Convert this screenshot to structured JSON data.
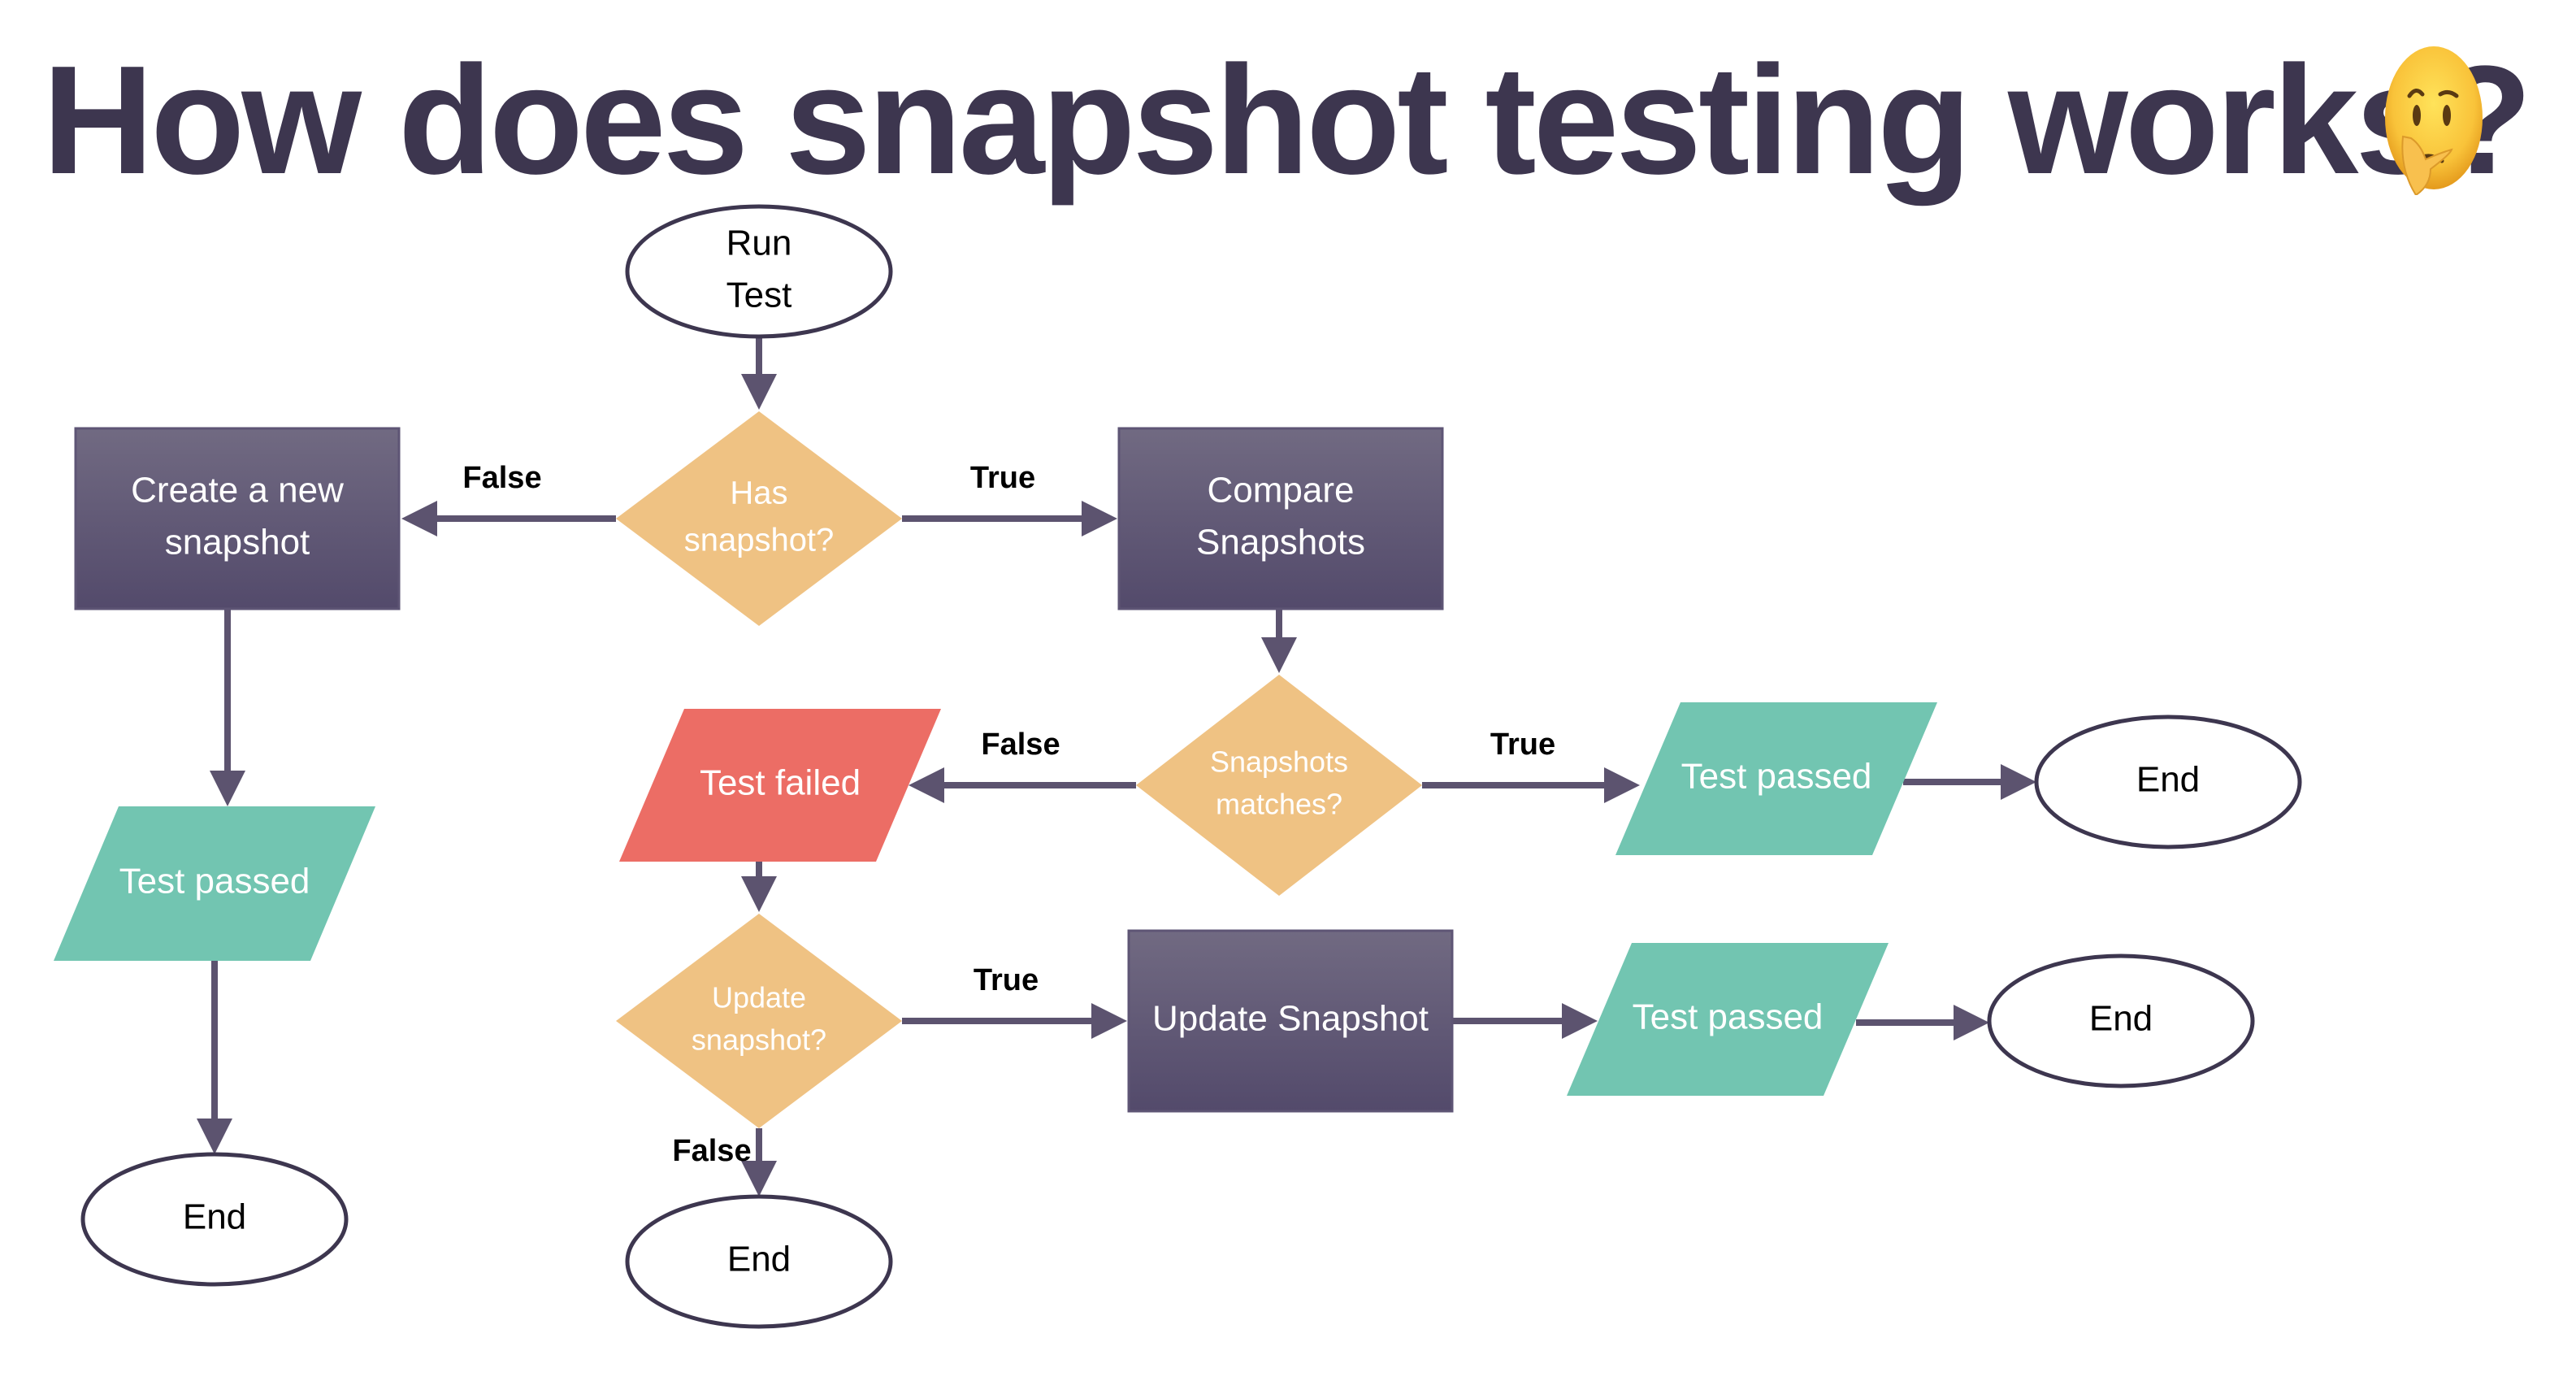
{
  "title": "How does snapshot testing works?",
  "title_emoji": "thinking-face-emoji",
  "colors": {
    "title": "#3d364f",
    "process_top": "#716a82",
    "process_bottom": "#534a6b",
    "decision": "#efc283",
    "passed": "#72c5b1",
    "failed": "#ec6d65",
    "connector": "#5c536f",
    "terminal_stroke": "#3d364f",
    "label": "#000000"
  },
  "nodes": {
    "run_test": {
      "type": "terminal",
      "lines": [
        "Run",
        "Test"
      ]
    },
    "has_snapshot": {
      "type": "decision",
      "lines": [
        "Has",
        "snapshot?"
      ]
    },
    "create_snapshot": {
      "type": "process",
      "lines": [
        "Create a new",
        "snapshot"
      ]
    },
    "compare_snapshots": {
      "type": "process",
      "lines": [
        "Compare",
        "Snapshots"
      ]
    },
    "snapshots_match": {
      "type": "decision",
      "lines": [
        "Snapshots",
        "matches?"
      ]
    },
    "test_failed": {
      "type": "io-failed",
      "lines": [
        "Test failed"
      ]
    },
    "test_passed_match": {
      "type": "io-passed",
      "lines": [
        "Test passed"
      ]
    },
    "end_match": {
      "type": "terminal",
      "lines": [
        "End"
      ]
    },
    "update_question": {
      "type": "decision",
      "lines": [
        "Update",
        "snapshot?"
      ]
    },
    "update_snapshot": {
      "type": "process",
      "lines": [
        "Update Snapshot"
      ]
    },
    "test_passed_update": {
      "type": "io-passed",
      "lines": [
        "Test passed"
      ]
    },
    "end_update": {
      "type": "terminal",
      "lines": [
        "End"
      ]
    },
    "test_passed_new": {
      "type": "io-passed",
      "lines": [
        "Test passed"
      ]
    },
    "end_new": {
      "type": "terminal",
      "lines": [
        "End"
      ]
    },
    "end_no_update": {
      "type": "terminal",
      "lines": [
        "End"
      ]
    }
  },
  "edges": [
    {
      "from": "run_test",
      "to": "has_snapshot",
      "label": ""
    },
    {
      "from": "has_snapshot",
      "to": "create_snapshot",
      "label": "False"
    },
    {
      "from": "has_snapshot",
      "to": "compare_snapshots",
      "label": "True"
    },
    {
      "from": "create_snapshot",
      "to": "test_passed_new",
      "label": ""
    },
    {
      "from": "test_passed_new",
      "to": "end_new",
      "label": ""
    },
    {
      "from": "compare_snapshots",
      "to": "snapshots_match",
      "label": ""
    },
    {
      "from": "snapshots_match",
      "to": "test_failed",
      "label": "False"
    },
    {
      "from": "snapshots_match",
      "to": "test_passed_match",
      "label": "True"
    },
    {
      "from": "test_passed_match",
      "to": "end_match",
      "label": ""
    },
    {
      "from": "test_failed",
      "to": "update_question",
      "label": ""
    },
    {
      "from": "update_question",
      "to": "update_snapshot",
      "label": "True"
    },
    {
      "from": "update_question",
      "to": "end_no_update",
      "label": "False"
    },
    {
      "from": "update_snapshot",
      "to": "test_passed_update",
      "label": ""
    },
    {
      "from": "test_passed_update",
      "to": "end_update",
      "label": ""
    }
  ]
}
